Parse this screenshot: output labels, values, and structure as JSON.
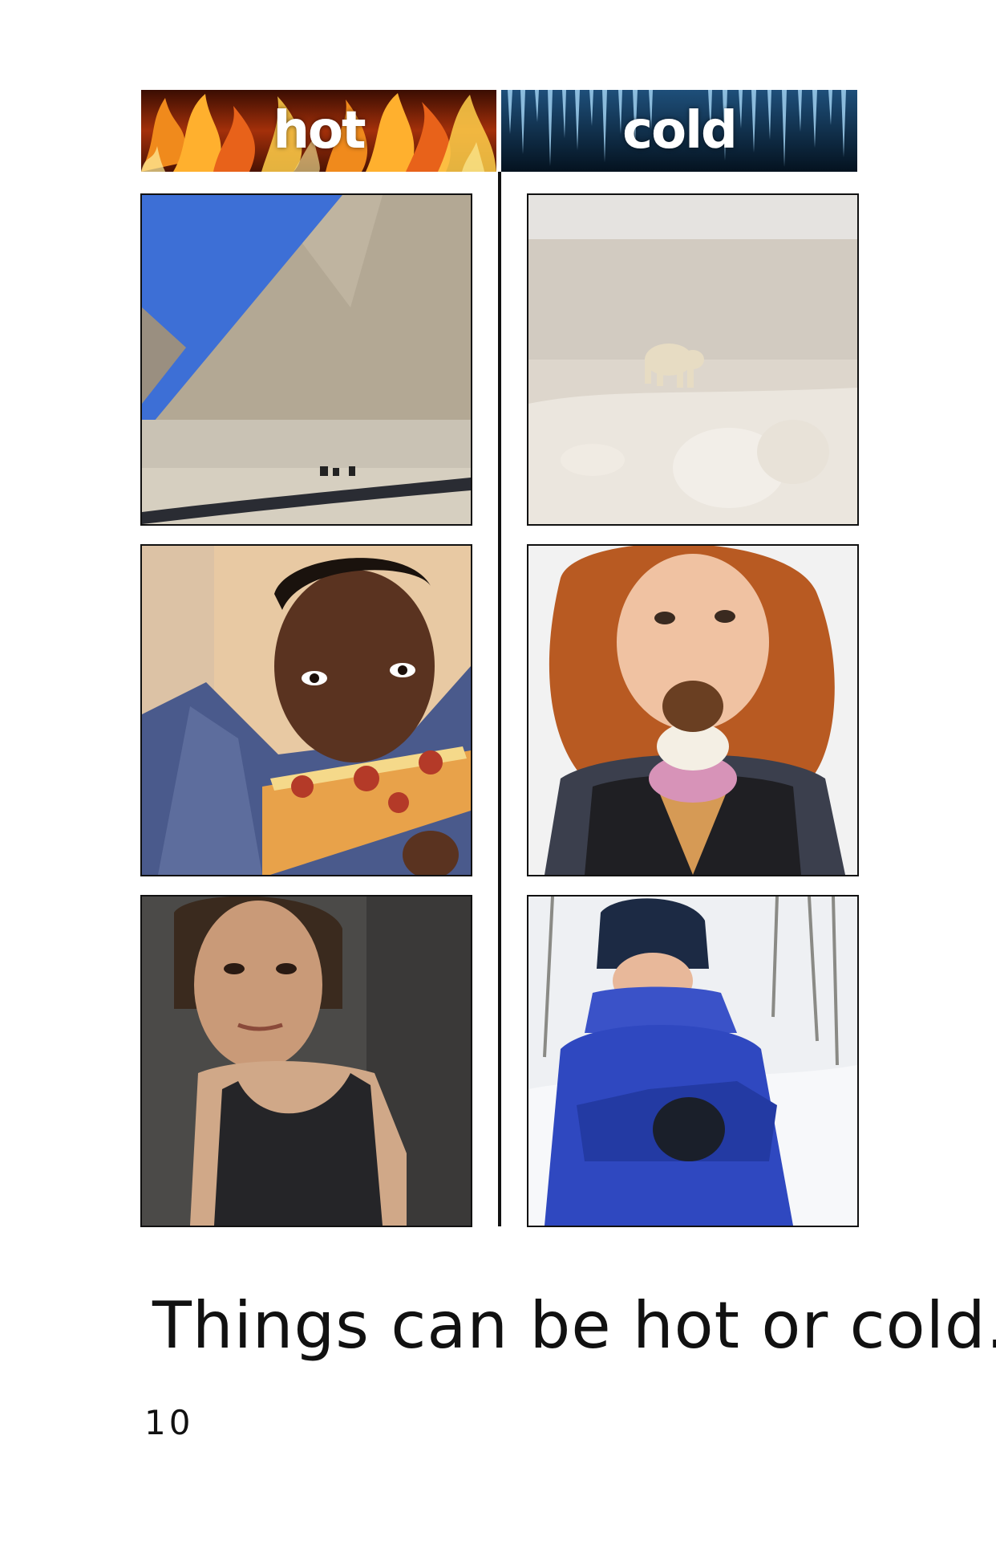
{
  "headers": {
    "hot": "hot",
    "cold": "cold"
  },
  "photos": {
    "hot": [
      "pyramid-desert",
      "boy-eating-pizza",
      "sweaty-woman-athlete"
    ],
    "cold": [
      "polar-bear-on-ice",
      "girl-eating-ice-cream",
      "child-in-snow-jacket"
    ]
  },
  "caption": "Things can be hot or cold.",
  "page_number": "10",
  "colors": {
    "fire": "#e8621a",
    "ice": "#0d2f4f",
    "rule": "#111111"
  }
}
